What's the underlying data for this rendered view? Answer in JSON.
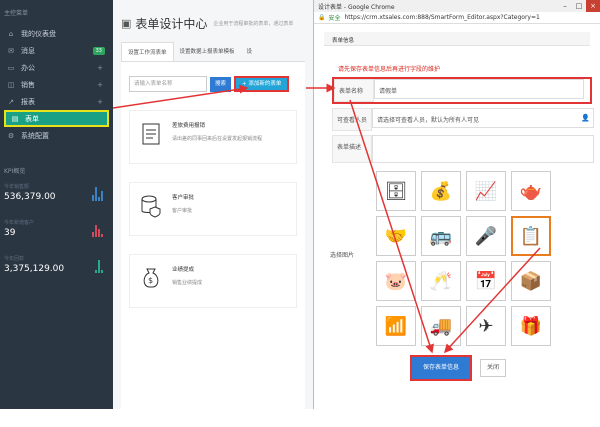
{
  "sidebar": {
    "header": "主控菜单",
    "items": [
      {
        "label": "我的仪表盘",
        "icon": "dashboard-icon"
      },
      {
        "label": "消息",
        "icon": "message-icon",
        "badge": "33"
      },
      {
        "label": "办公",
        "icon": "desktop-icon",
        "plus": "+"
      },
      {
        "label": "销售",
        "icon": "bag-icon",
        "plus": "+"
      },
      {
        "label": "报表",
        "icon": "chart-icon",
        "plus": "+"
      },
      {
        "label": "表单",
        "icon": "table-icon",
        "active": true
      },
      {
        "label": "系统配置",
        "icon": "gear-icon"
      }
    ],
    "kpi_title": "KPI概览",
    "kpis": [
      {
        "label": "今年销售额",
        "value": "536,379.00",
        "color": "#3b82c4"
      },
      {
        "label": "今年新增客户",
        "value": "39",
        "color": "#d04a5a"
      },
      {
        "label": "今年回款",
        "value": "3,375,129.00",
        "color": "#2aa88a"
      }
    ]
  },
  "main": {
    "title": "表单设计中心",
    "subtitle": "企业用于流程审批的表单，通过表单",
    "tabs": [
      "设置工作流表单",
      "设置数据上报表单模板",
      "设"
    ],
    "search_placeholder": "请输入表单名称",
    "search_button": "搜索",
    "add_button": "+ 添加新的表单",
    "cards": [
      {
        "title": "差旅费用报销",
        "desc": "请出差的同事回来后在设置发起报销流程"
      },
      {
        "title": "客户审批",
        "desc": "客户审批"
      },
      {
        "title": "业绩提成",
        "desc": "销售业绩提成"
      }
    ]
  },
  "browser": {
    "title": "设计表单 - Google Chrome",
    "secure": "安全",
    "url": "https://crm.xtsales.com:888/SmartForm_Editor.aspx?Category=1",
    "form_tab": "表单信息",
    "notice": "请先保存表单信息后再进行字段的维护",
    "fields": [
      {
        "label": "表单名称",
        "value": "请假单"
      },
      {
        "label": "可查看人员",
        "value": "请选择可查看人员，默认为所有人可见"
      },
      {
        "label": "表单描述",
        "value": ""
      }
    ],
    "icon_label": "选择图片",
    "icons": [
      "🗄",
      "💰",
      "📈",
      "🫖",
      "🤝",
      "🚌",
      "🎤",
      "📋",
      "🐷",
      "🥂",
      "📅",
      "📦",
      "📶",
      "🚚",
      "✈",
      "🎁"
    ],
    "save_button": "保存表单信息",
    "close_button": "关闭"
  }
}
